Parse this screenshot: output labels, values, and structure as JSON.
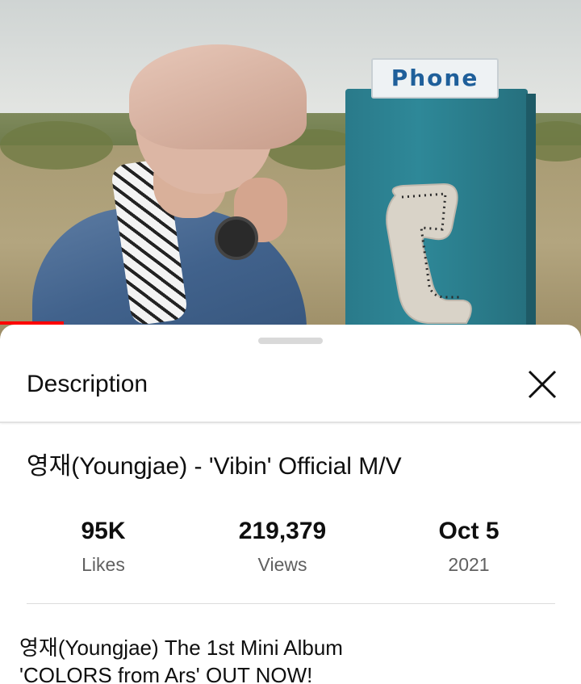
{
  "video": {
    "booth_sign": "Phone",
    "progress_fraction": 0.11
  },
  "sheet": {
    "title": "Description",
    "close_icon": "close-icon"
  },
  "video_title": "영재(Youngjae) - 'Vibin' Official M/V",
  "stats": {
    "likes": {
      "value": "95K",
      "label": "Likes"
    },
    "views": {
      "value": "219,379",
      "label": "Views"
    },
    "date": {
      "value": "Oct 5",
      "label": "2021"
    }
  },
  "description": {
    "line1": "영재(Youngjae) The 1st Mini Album",
    "line2": "'COLORS from Ars' OUT NOW!"
  },
  "colors": {
    "progress": "#ff0000",
    "booth": "#2e8898",
    "sign_text": "#1f5f9a"
  }
}
